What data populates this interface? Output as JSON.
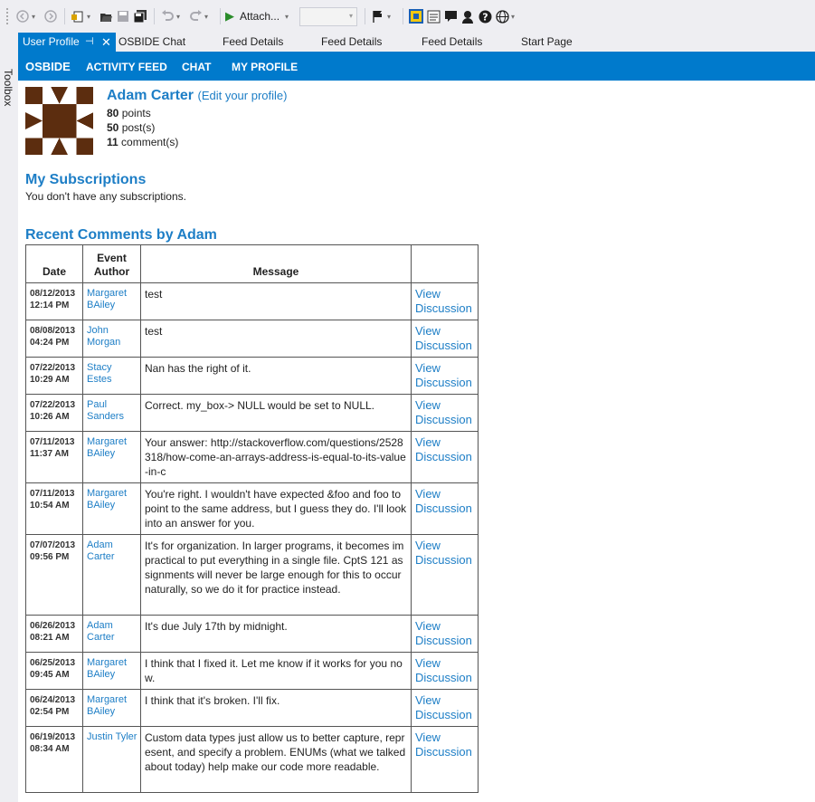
{
  "toolbar": {
    "attach_label": "Attach...",
    "items": [
      "back-icon",
      "forward-icon",
      "new-project-icon",
      "open-file-icon",
      "save-icon",
      "save-all-icon",
      "undo-icon",
      "redo-icon"
    ]
  },
  "toolbox_label": "Toolbox",
  "tabs": [
    {
      "label": "User Profile",
      "active": true
    },
    {
      "label": "OSBIDE Chat"
    },
    {
      "label": "Feed Details"
    },
    {
      "label": "Feed Details"
    },
    {
      "label": "Feed Details"
    },
    {
      "label": "Start Page"
    }
  ],
  "nav": {
    "brand": "OSBIDE",
    "items": [
      "ACTIVITY FEED",
      "CHAT",
      "MY PROFILE"
    ]
  },
  "profile": {
    "name": "Adam Carter",
    "edit_link": "(Edit your profile)",
    "points_value": "80",
    "points_label": "points",
    "posts_value": "50",
    "posts_label": "post(s)",
    "comments_value": "11",
    "comments_label": "comment(s)",
    "avatar_colors": {
      "fg": "#5c2d0f",
      "bg": "#ffffff"
    }
  },
  "subscriptions": {
    "title": "My Subscriptions",
    "empty_text": "You don't have any subscriptions."
  },
  "recent": {
    "title": "Recent Comments by Adam",
    "columns": [
      "Date",
      "Event Author",
      "Message",
      ""
    ],
    "rows": [
      {
        "date": "08/12/2013",
        "time": "12:14 PM",
        "author": "Margaret BAiley",
        "message": "test",
        "link_1": "View",
        "link_2": "Discussion"
      },
      {
        "date": "08/08/2013",
        "time": "04:24 PM",
        "author": "John Morgan",
        "message": "test",
        "link_1": "View",
        "link_2": "Discussion"
      },
      {
        "date": "07/22/2013",
        "time": "10:29 AM",
        "author": "Stacy Estes",
        "message": "Nan has the right of it.",
        "link_1": "View",
        "link_2": "Discussion"
      },
      {
        "date": "07/22/2013",
        "time": "10:26 AM",
        "author": "Paul Sanders",
        "message": "Correct. my_box-> NULL would be set to NULL.",
        "link_1": "View",
        "link_2": "Discussion"
      },
      {
        "date": "07/11/2013",
        "time": "11:37 AM",
        "author": "Margaret BAiley",
        "message": "Your answer: http://stackoverflow.com/questions/2528318/how-come-an-arrays-address-is-equal-to-its-value-in-c",
        "link_1": "View",
        "link_2": "Discussion"
      },
      {
        "date": "07/11/2013",
        "time": "10:54 AM",
        "author": "Margaret BAiley",
        "message": "You're right. I wouldn't have expected &foo and foo to point to the same address, but I guess they do. I'll look into an answer for you.",
        "link_1": "View",
        "link_2": "Discussion"
      },
      {
        "date": "07/07/2013",
        "time": "09:56 PM",
        "author": "Adam Carter",
        "message": "It's for organization. In larger programs, it becomes impractical to put everything in a single file. CptS 121 assignments will never be large enough for this to occur naturally, so we do it for practice instead.",
        "link_1": "View",
        "link_2": "Discussion"
      },
      {
        "date": "06/26/2013",
        "time": "08:21 AM",
        "author": "Adam Carter",
        "message": "It's due July 17th by midnight.",
        "link_1": "View",
        "link_2": "Discussion"
      },
      {
        "date": "06/25/2013",
        "time": "09:45 AM",
        "author": "Margaret BAiley",
        "message": "I think that I fixed it. Let me know if it works for you now.",
        "link_1": "View",
        "link_2": "Discussion"
      },
      {
        "date": "06/24/2013",
        "time": "02:54 PM",
        "author": "Margaret BAiley",
        "message": "I think that it's broken. I'll fix.",
        "link_1": "View",
        "link_2": "Discussion"
      },
      {
        "date": "06/19/2013",
        "time": "08:34 AM",
        "author": "Justin Tyler",
        "message": "Custom data types just allow us to better capture, represent, and specify a problem. ENUMs (what we talked about today) help make our code more readable.",
        "link_1": "View",
        "link_2": "Discussion"
      }
    ]
  },
  "colors": {
    "accent": "#007acc",
    "link": "#1d7ec6",
    "chrome": "#eeeef2"
  }
}
